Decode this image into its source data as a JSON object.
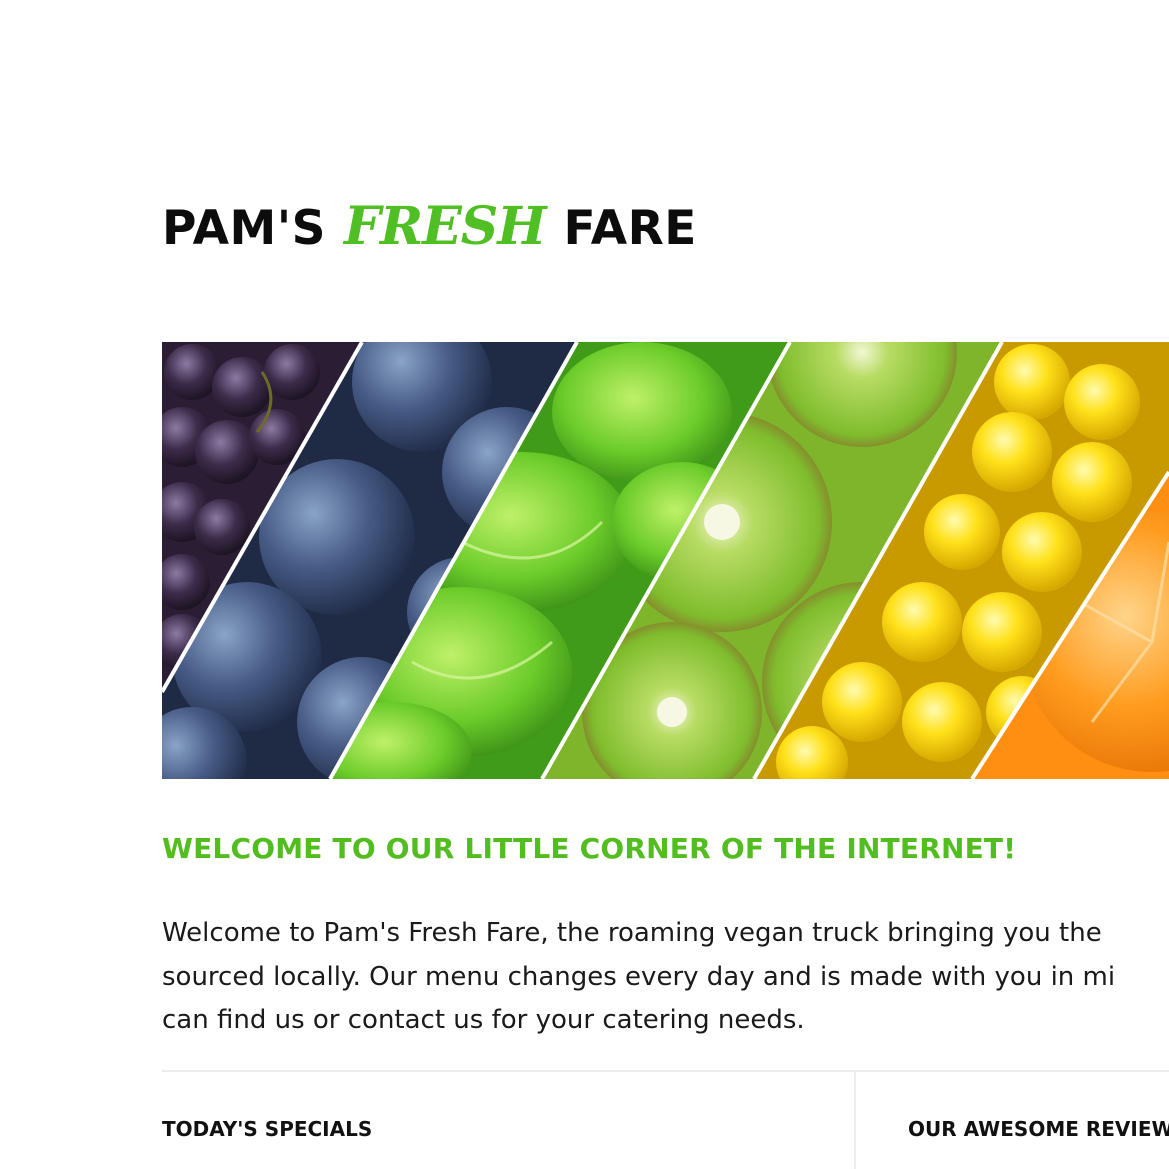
{
  "brand": {
    "part1": "PAM'S",
    "accent": "FRESH",
    "part2": "FARE",
    "accent_color": "#4fbf24"
  },
  "hero": {
    "alt": "Diagonal strips of grapes, plums, lettuce, kiwi, corn and oranges",
    "strips": [
      "grapes",
      "plums",
      "lettuce",
      "kiwi",
      "corn",
      "orange"
    ]
  },
  "welcome": {
    "headline": "WELCOME TO OUR LITTLE CORNER OF THE INTERNET!",
    "lines": [
      "Welcome to Pam's Fresh Fare, the roaming vegan truck bringing you the",
      "sourced locally. Our menu changes every day and is made with you in mi",
      "can find us or contact us for your catering needs."
    ]
  },
  "sections": {
    "specials_title": "TODAY'S SPECIALS",
    "reviews_title": "OUR AWESOME REVIEW"
  },
  "colors": {
    "accent_green": "#52bd1f",
    "text": "#1a1a1a",
    "divider": "#ededed"
  }
}
